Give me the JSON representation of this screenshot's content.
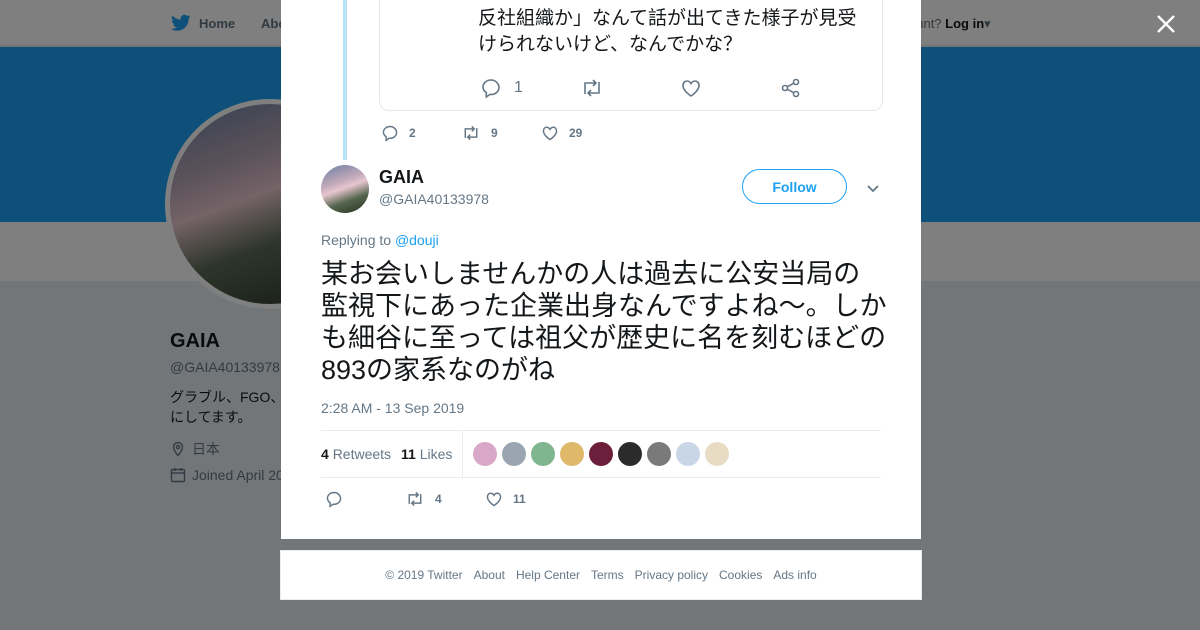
{
  "topbar": {
    "home_label": "Home",
    "about_label": "Abo",
    "account_prompt": "ccount?",
    "login_label": "Log in"
  },
  "profile": {
    "name": "GAIA",
    "handle": "@GAIA40133978",
    "bio": "グラブル、FGO、主にしてます。",
    "location": "日本",
    "joined": "Joined April 20"
  },
  "quoted": {
    "text": "反社組織か」なんて話が出てきた様子が見受けられないけど、なんでかな？",
    "reply_count": "1"
  },
  "previous_tweet": {
    "replies": "2",
    "retweets": "9",
    "likes": "29"
  },
  "tweet": {
    "name": "GAIA",
    "handle": "@GAIA40133978",
    "follow_label": "Follow",
    "replying_prefix": "Replying to",
    "replying_to": "@douji",
    "text": "某お会いしませんかの人は過去に公安当局の監視下にあった企業出身なんですよね～。しかも細谷に至っては祖父が歴史に名を刻むほどの893の家系なのがね",
    "timestamp": "2:28 AM - 13 Sep 2019",
    "retweets_count": "4",
    "retweets_label": "Retweets",
    "likes_count": "11",
    "likes_label": "Likes",
    "likers": [
      {
        "name": "liker-1",
        "color": "#d9a7c7"
      },
      {
        "name": "liker-2",
        "color": "#9aa5b1"
      },
      {
        "name": "liker-3",
        "color": "#7fb58f"
      },
      {
        "name": "liker-4",
        "color": "#e0b86a"
      },
      {
        "name": "liker-5",
        "color": "#6b1f3a"
      },
      {
        "name": "liker-6",
        "color": "#2b2b2b"
      },
      {
        "name": "liker-7",
        "color": "#7a7a7a"
      },
      {
        "name": "liker-8",
        "color": "#c9d6e6"
      },
      {
        "name": "liker-9",
        "color": "#e9dcc4"
      }
    ],
    "action_retweets": "4",
    "action_likes": "11"
  },
  "footer": {
    "copyright": "© 2019 Twitter",
    "links": [
      "About",
      "Help Center",
      "Terms",
      "Privacy policy",
      "Cookies",
      "Ads info"
    ]
  },
  "colors": {
    "brand": "#1da1f2",
    "overlay": "rgba(0,0,0,0.5)"
  }
}
